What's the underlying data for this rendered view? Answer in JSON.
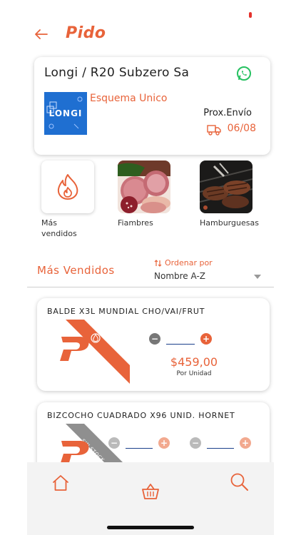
{
  "header": {
    "back_icon": "back-arrow-icon",
    "logo_text": "Pido",
    "accent_color": "#e8633a"
  },
  "client": {
    "name": "Longi / R20 Subzero Sa",
    "thumbnail_text": "LONGI",
    "scheme": "Esquema Unico",
    "next_shipment_label": "Prox.Envío",
    "next_shipment_date": "06/08",
    "whatsapp_icon": "whatsapp-icon",
    "truck_icon": "truck-icon"
  },
  "categories": [
    {
      "label": "Más vendidos",
      "icon": "fire-icon"
    },
    {
      "label": "Fiambres",
      "icon": "cold-cuts-image"
    },
    {
      "label": "Hamburguesas",
      "icon": "burgers-image"
    }
  ],
  "list": {
    "section_title": "Más Vendidos",
    "sort_label": "Ordenar por",
    "sort_value": "Nombre A-Z"
  },
  "products": [
    {
      "title": "BALDE X3L MUNDIAL CHO/VAI/FRUT",
      "price": "$459,00",
      "unit": "Por Unidad"
    },
    {
      "title": "BIZCOCHO CUADRADO X96 UNID. HORNET",
      "badge": "SIN STOCK"
    }
  ],
  "nav": {
    "home_icon": "home-icon",
    "cart_icon": "basket-icon",
    "search_icon": "search-icon"
  }
}
